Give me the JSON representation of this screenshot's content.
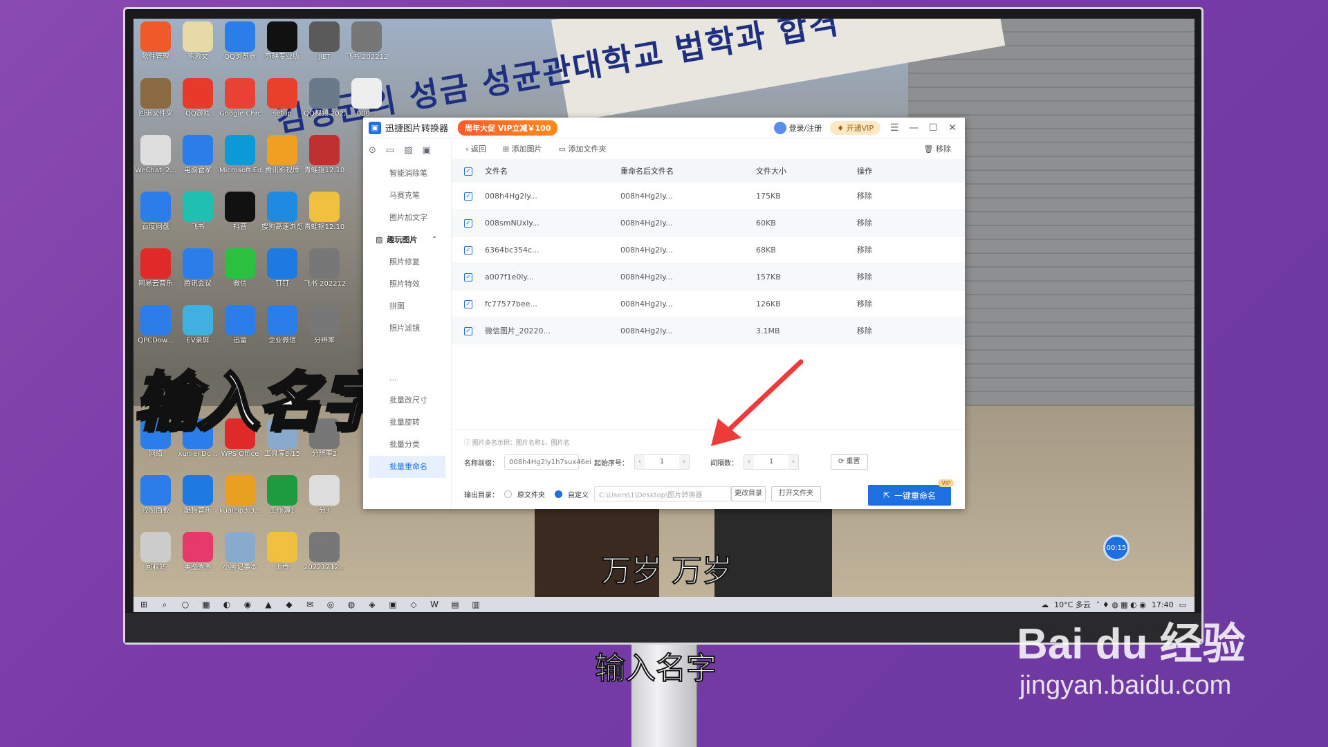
{
  "desktop": {
    "icons": [
      {
        "label": "软件管理",
        "color": "#f05a28",
        "col": 0,
        "row": 0
      },
      {
        "label": "陈激文",
        "color": "#e8d9a8",
        "col": 1,
        "row": 0
      },
      {
        "label": "QQ浏览器",
        "color": "#2b7de9",
        "col": 2,
        "row": 0
      },
      {
        "label": "剪映专业版",
        "color": "#111111",
        "col": 3,
        "row": 0
      },
      {
        "label": "JIET",
        "color": "#5a5a5a",
        "col": 4,
        "row": 0
      },
      {
        "label": "飞书 20221212...",
        "color": "#777777",
        "col": 5,
        "row": 0
      },
      {
        "label": "回退文件夹",
        "color": "#8a6a40",
        "col": 0,
        "row": 1
      },
      {
        "label": "QQ游戏",
        "color": "#e83a2a",
        "col": 1,
        "row": 1
      },
      {
        "label": "Google Chrome",
        "color": "#e94235",
        "col": 2,
        "row": 1
      },
      {
        "label": "setup",
        "color": "#e8402a",
        "col": 3,
        "row": 1
      },
      {
        "label": "QQ视频 20221212...",
        "color": "#6a7a8a",
        "col": 4,
        "row": 1
      },
      {
        "label": "000...",
        "color": "#eeeeee",
        "col": 5,
        "row": 1
      },
      {
        "label": "WeChat_2...",
        "color": "#dddddd",
        "col": 0,
        "row": 2
      },
      {
        "label": "电脑管家",
        "color": "#2b7de9",
        "col": 1,
        "row": 2
      },
      {
        "label": "Microsoft Edge",
        "color": "#0c9bd8",
        "col": 2,
        "row": 2
      },
      {
        "label": "腾讯影视库",
        "color": "#f0a020",
        "col": 3,
        "row": 2
      },
      {
        "label": "青蛙抠12.10",
        "color": "#c03030",
        "col": 4,
        "row": 2
      },
      {
        "label": "百度网盘",
        "color": "#2b7de9",
        "col": 0,
        "row": 3
      },
      {
        "label": "飞书",
        "color": "#1ec0b0",
        "col": 1,
        "row": 3
      },
      {
        "label": "抖音",
        "color": "#111111",
        "col": 2,
        "row": 3
      },
      {
        "label": "搜狗高速浏览器",
        "color": "#1e8ae0",
        "col": 3,
        "row": 3
      },
      {
        "label": "青蛙抠12.10",
        "color": "#f0c040",
        "col": 4,
        "row": 3
      },
      {
        "label": "网易云音乐",
        "color": "#e02a2a",
        "col": 0,
        "row": 4
      },
      {
        "label": "腾讯会议",
        "color": "#2b7de9",
        "col": 1,
        "row": 4
      },
      {
        "label": "微信",
        "color": "#2ac040",
        "col": 2,
        "row": 4
      },
      {
        "label": "钉钉",
        "color": "#1e7ae0",
        "col": 3,
        "row": 4
      },
      {
        "label": "飞书 20221212...",
        "color": "#777777",
        "col": 4,
        "row": 4
      },
      {
        "label": "QPCDow...",
        "color": "#2b7de9",
        "col": 0,
        "row": 5
      },
      {
        "label": "EV录屏",
        "color": "#40b0e0",
        "col": 1,
        "row": 5
      },
      {
        "label": "迅雷",
        "color": "#2b7de9",
        "col": 2,
        "row": 5
      },
      {
        "label": "企业微信",
        "color": "#2b7de9",
        "col": 3,
        "row": 5
      },
      {
        "label": "分辨率",
        "color": "#777777",
        "col": 4,
        "row": 5
      },
      {
        "label": "网络",
        "color": "#2b7de9",
        "col": 0,
        "row": 7
      },
      {
        "label": "xunlei Do...",
        "color": "#2b7de9",
        "col": 1,
        "row": 7
      },
      {
        "label": "WPS Office",
        "color": "#e02a2a",
        "col": 2,
        "row": 7
      },
      {
        "label": "工具库8.15",
        "color": "#88aacc",
        "col": 3,
        "row": 7
      },
      {
        "label": "分辨率2",
        "color": "#777777",
        "col": 4,
        "row": 7
      },
      {
        "label": "控制面板",
        "color": "#2b7de9",
        "col": 0,
        "row": 8
      },
      {
        "label": "酷狗音乐",
        "color": "#1e7ae0",
        "col": 1,
        "row": 8
      },
      {
        "label": "kuaizip3.3...",
        "color": "#e8a020",
        "col": 2,
        "row": 8
      },
      {
        "label": "工作簿1",
        "color": "#1e9a40",
        "col": 3,
        "row": 8
      },
      {
        "label": "分3",
        "color": "#dddddd",
        "col": 4,
        "row": 8
      },
      {
        "label": "回收站",
        "color": "#cccccc",
        "col": 0,
        "row": 9
      },
      {
        "label": "美图秀秀",
        "color": "#e83a6a",
        "col": 1,
        "row": 9
      },
      {
        "label": "小黑记事本",
        "color": "#88aacc",
        "col": 2,
        "row": 9
      },
      {
        "label": "上传",
        "color": "#f0c040",
        "col": 3,
        "row": 9
      },
      {
        "label": "20221212...",
        "color": "#777777",
        "col": 4,
        "row": 9
      }
    ]
  },
  "background": {
    "banner": "김성균의 성금 성균관대학교 법학과 합격"
  },
  "overlay": {
    "big_title": "输入名字",
    "screen_subtitle": "万岁 万岁",
    "timer": "00:15"
  },
  "app": {
    "logo_icon": "image-icon",
    "name": "迅捷图片转换器",
    "promo": "周年大促 VIP立减￥100",
    "login": "登录/注册",
    "vip": "开通VIP",
    "window_controls": [
      "☰",
      "—",
      "☐",
      "✕"
    ],
    "sidebar": {
      "top_icons": [
        "⊙",
        "▭",
        "▨",
        "▣"
      ],
      "items_a": [
        "智能消除笔",
        "马赛克笔",
        "图片加文字"
      ],
      "group": "趣玩图片",
      "items_b": [
        "照片修复",
        "照片特效",
        "拼图",
        "照片滤镜"
      ],
      "items_c": [
        "...",
        "批量改尺寸",
        "批量旋转",
        "批量分类",
        "批量重命名"
      ]
    },
    "toolbar": {
      "back": "返回",
      "add_image": "添加图片",
      "add_folder": "添加文件夹",
      "remove": "移除"
    },
    "table": {
      "headers": [
        "文件名",
        "重命名后文件名",
        "文件大小",
        "操作"
      ],
      "rows": [
        {
          "name": "008h4Hg2ly...",
          "rename": "008h4Hg2ly...",
          "size": "175KB",
          "op": "移除"
        },
        {
          "name": "008smNUxly...",
          "rename": "008h4Hg2ly...",
          "size": "60KB",
          "op": "移除"
        },
        {
          "name": "6364bc354c...",
          "rename": "008h4Hg2ly...",
          "size": "68KB",
          "op": "移除"
        },
        {
          "name": "a007f1e0ly...",
          "rename": "008h4Hg2ly...",
          "size": "157KB",
          "op": "移除"
        },
        {
          "name": "fc77577bee...",
          "rename": "008h4Hg2ly...",
          "size": "126KB",
          "op": "移除"
        },
        {
          "name": "微信图片_20220...",
          "rename": "008h4Hg2ly...",
          "size": "3.1MB",
          "op": "移除"
        }
      ]
    },
    "bottom": {
      "hint": "ⓘ 图片命名示例：图片名称1、图片名",
      "prefix_label": "名称前缀：",
      "prefix_value": "008h4Hg2ly1h7sux46ei",
      "start_label": "起始序号：",
      "start_value": "1",
      "interval_label": "间隔数：",
      "interval_value": "1",
      "reset": "重置",
      "output_label": "输出目录：",
      "opt_original": "原文件夹",
      "opt_custom": "自定义",
      "path": "C:\\Users\\1\\Desktop\\图片转换器",
      "change_dir": "更改目录",
      "open_folder": "打开文件夹",
      "rename_button": "一键重命名",
      "vip_tag": "VIP"
    }
  },
  "taskbar": {
    "icons": [
      "⊞",
      "⌕",
      "○",
      "▦",
      "◐",
      "◉",
      "▲",
      "◆",
      "✉",
      "◎",
      "◍",
      "◈",
      "▣",
      "◇",
      "W",
      "▤",
      "▥"
    ],
    "weather": "10°C 多云",
    "time": "17:40"
  },
  "subtitle_bottom": "输入名字",
  "watermark": {
    "main": "Bai du 经验",
    "sub": "jingyan.baidu.com"
  }
}
